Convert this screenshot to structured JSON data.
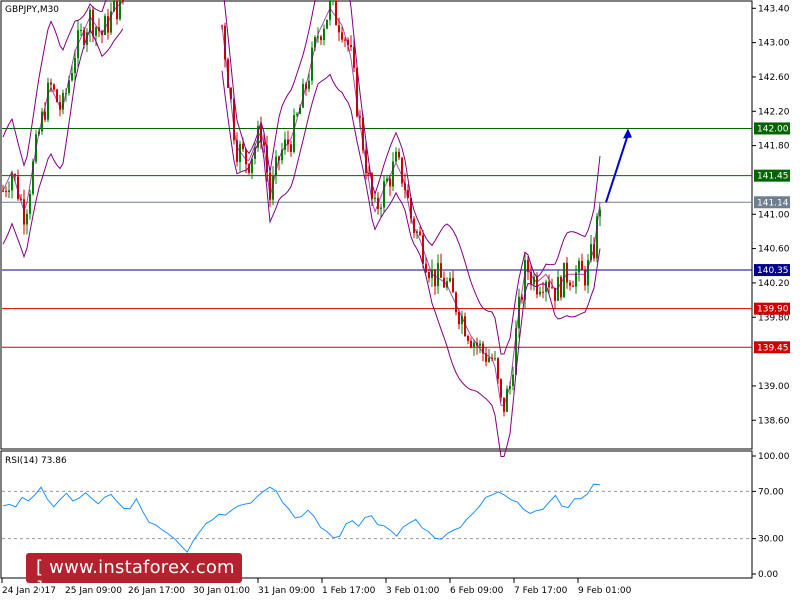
{
  "chart_data": [
    {
      "type": "candlestick",
      "title": "GBPJPY,M30",
      "ylim": [
        138.3,
        143.45
      ],
      "y_ticks": [
        "143.40",
        "143.00",
        "142.60",
        "142.20",
        "141.80",
        "141.00",
        "140.60",
        "140.20",
        "139.80",
        "139.00",
        "138.60"
      ],
      "x_ticks": [
        "24 Jan 2017",
        "25 Jan 09:00",
        "26 Jan 17:00",
        "30 Jan 01:00",
        "31 Jan 09:00",
        "1 Feb 17:00",
        "3 Feb 01:00",
        "6 Feb 09:00",
        "7 Feb 17:00",
        "9 Feb 01:00"
      ],
      "levels": [
        {
          "value": 142.0,
          "label": "142.00",
          "color": "#006400"
        },
        {
          "value": 141.45,
          "label": "141.45",
          "color": "#006400"
        },
        {
          "value": 141.14,
          "label": "141.14",
          "color": "#6f7f8f"
        },
        {
          "value": 140.35,
          "label": "140.35",
          "color": "#00008b"
        },
        {
          "value": 139.9,
          "label": "139.90",
          "color": "#d00000"
        },
        {
          "value": 139.45,
          "label": "139.45",
          "color": "#d00000"
        }
      ],
      "price_path": [
        [
          0,
          141.2
        ],
        [
          12,
          141.5
        ],
        [
          25,
          141.0
        ],
        [
          38,
          141.9
        ],
        [
          50,
          142.5
        ],
        [
          62,
          142.2
        ],
        [
          75,
          142.9
        ],
        [
          90,
          143.3
        ],
        [
          102,
          143.1
        ],
        [
          115,
          143.4
        ],
        [
          125,
          143.5
        ],
        [
          220,
          143.4
        ],
        [
          228,
          142.6
        ],
        [
          236,
          141.8
        ],
        [
          248,
          141.6
        ],
        [
          262,
          142.0
        ],
        [
          270,
          141.2
        ],
        [
          280,
          141.7
        ],
        [
          292,
          141.9
        ],
        [
          304,
          142.4
        ],
        [
          318,
          143.1
        ],
        [
          330,
          143.4
        ],
        [
          342,
          143.2
        ],
        [
          350,
          142.9
        ],
        [
          358,
          142.2
        ],
        [
          366,
          141.6
        ],
        [
          374,
          141.0
        ],
        [
          384,
          141.3
        ],
        [
          396,
          141.6
        ],
        [
          404,
          141.4
        ],
        [
          412,
          140.9
        ],
        [
          420,
          140.7
        ],
        [
          432,
          140.3
        ],
        [
          446,
          140.2
        ],
        [
          458,
          139.9
        ],
        [
          470,
          139.6
        ],
        [
          482,
          139.4
        ],
        [
          494,
          139.3
        ],
        [
          502,
          138.7
        ],
        [
          510,
          139.0
        ],
        [
          518,
          139.8
        ],
        [
          526,
          140.4
        ],
        [
          536,
          140.2
        ],
        [
          546,
          140.3
        ],
        [
          556,
          140.1
        ],
        [
          566,
          140.3
        ],
        [
          576,
          140.3
        ],
        [
          586,
          140.3
        ],
        [
          594,
          140.6
        ],
        [
          600,
          141.14
        ]
      ],
      "bands_offset": 0.45,
      "forecast": {
        "from": [
          606,
          141.14
        ],
        "to": [
          628,
          142.0
        ],
        "color": "#0000cc"
      },
      "colors": {
        "up": "#008000",
        "down": "#d00000",
        "band": "#800080",
        "axis": "#000000",
        "tag_text": "#ffffff"
      }
    },
    {
      "type": "line",
      "title": "RSI(14) 73.86",
      "ylim": [
        0,
        100
      ],
      "y_ticks": [
        "100.00",
        "70.00",
        "30.00",
        "0.00"
      ],
      "levels": [
        70,
        30
      ],
      "values": [
        55,
        62,
        58,
        66,
        60,
        64,
        72,
        65,
        58,
        62,
        68,
        60,
        64,
        70,
        62,
        58,
        63,
        66,
        60,
        55,
        58,
        62,
        50,
        46,
        42,
        38,
        35,
        32,
        25,
        20,
        30,
        38,
        45,
        48,
        52,
        50,
        55,
        60,
        58,
        62,
        68,
        72,
        76,
        70,
        62,
        55,
        50,
        48,
        52,
        46,
        40,
        36,
        30,
        34,
        40,
        45,
        42,
        48,
        52,
        44,
        40,
        36,
        34,
        38,
        42,
        44,
        40,
        35,
        30,
        28,
        32,
        36,
        40,
        44,
        50,
        56,
        62,
        70,
        72,
        66,
        60,
        58,
        56,
        54,
        52,
        56,
        60,
        64,
        60,
        58,
        62,
        66,
        70,
        74,
        73.86
      ],
      "colors": {
        "line": "#1e90ff",
        "level": "#999999"
      }
    }
  ],
  "watermark": {
    "text": "[  www.instaforex.com  ]"
  }
}
